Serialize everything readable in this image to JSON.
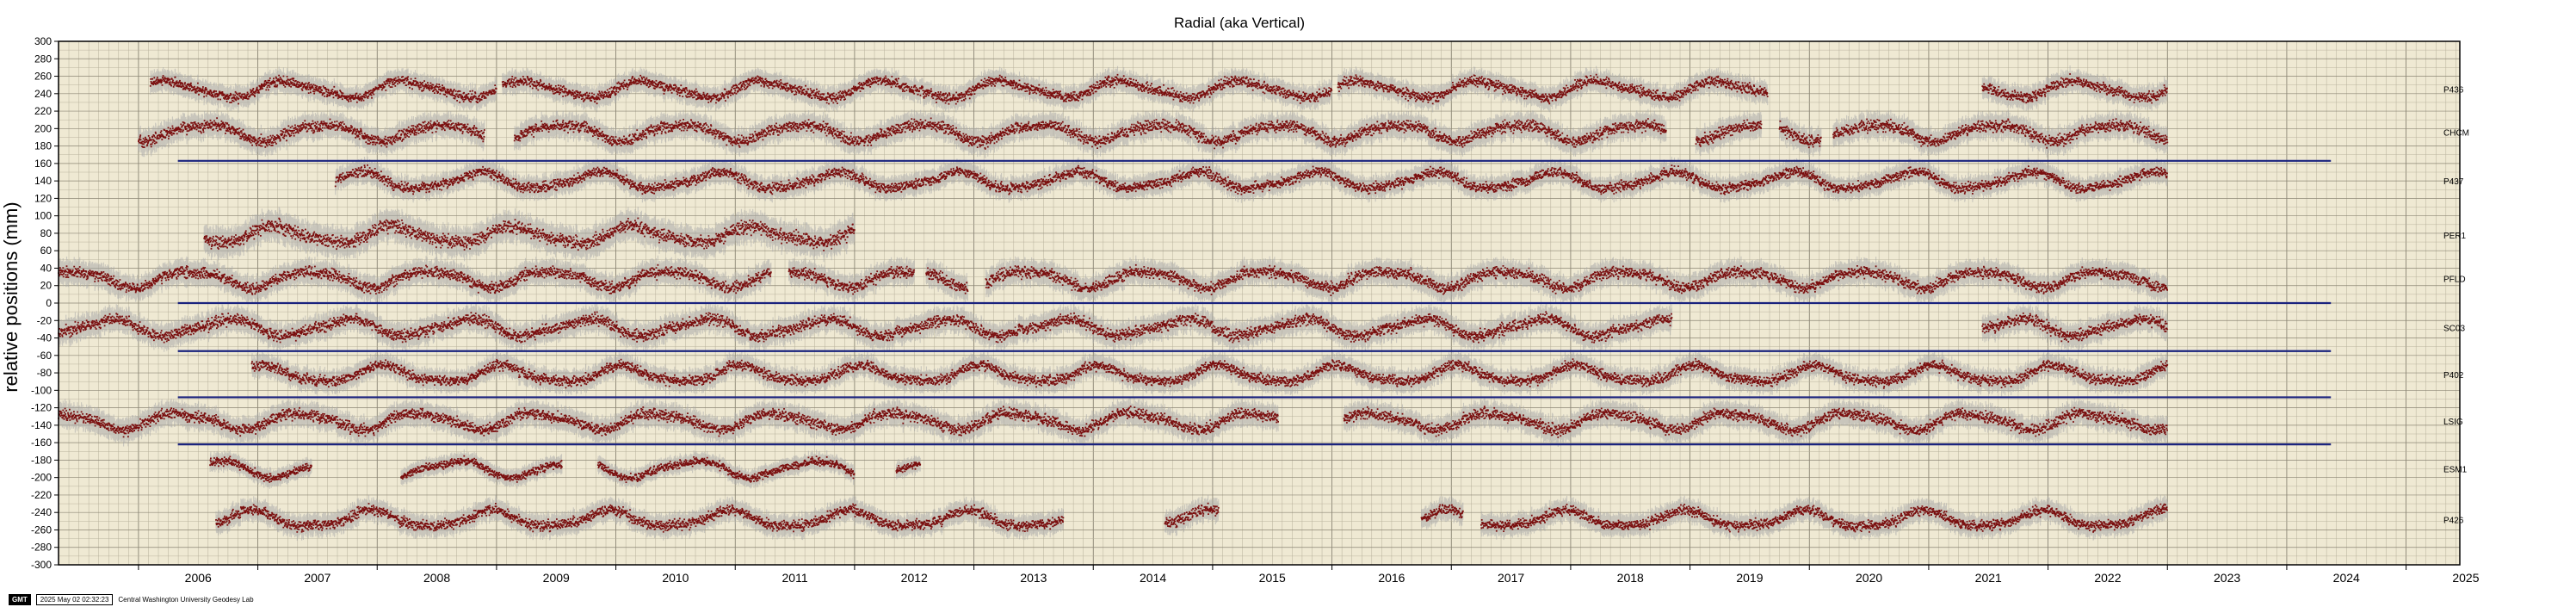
{
  "chart_data": {
    "type": "scatter",
    "title": "Radial (aka Vertical)",
    "xlabel": "",
    "ylabel": "relative positions (mm)",
    "xlim": [
      2005.33,
      2025.45
    ],
    "ylim": [
      -300,
      300
    ],
    "x_ticks": [
      "2006",
      "2007",
      "2008",
      "2009",
      "2010",
      "2011",
      "2012",
      "2013",
      "2014",
      "2015",
      "2016",
      "2017",
      "2018",
      "2019",
      "2020",
      "2021",
      "2022",
      "2023",
      "2024",
      "2025"
    ],
    "y_ticks": [
      300,
      280,
      260,
      240,
      220,
      200,
      180,
      160,
      140,
      120,
      100,
      80,
      60,
      40,
      20,
      0,
      -20,
      -40,
      -60,
      -80,
      -100,
      -120,
      -140,
      -160,
      -180,
      -200,
      -220,
      -240,
      -260,
      -280,
      -300
    ],
    "grid": true,
    "marker_color": "#7a0e0e",
    "scatter_color": "#a9a9a9",
    "background_color": "#efe9d3",
    "hline_color": "#1a237e",
    "hlines": [
      {
        "y": 163,
        "x": [
          2006.33,
          2024.37
        ]
      },
      {
        "y": 0,
        "x": [
          2006.33,
          2024.37
        ]
      },
      {
        "y": -55,
        "x": [
          2006.33,
          2024.37
        ]
      },
      {
        "y": -108,
        "x": [
          2006.33,
          2024.37
        ]
      },
      {
        "y": -162,
        "x": [
          2006.33,
          2024.37
        ]
      }
    ],
    "series": [
      {
        "name": "P436",
        "offset": 245,
        "spread": 9,
        "segments": [
          [
            2006.1,
            2009.0
          ],
          [
            2009.05,
            2016.0
          ],
          [
            2016.05,
            2019.65
          ],
          [
            2021.45,
            2023.0
          ]
        ]
      },
      {
        "name": "CHCM",
        "offset": 196,
        "spread": 10,
        "segments": [
          [
            2006.0,
            2008.9
          ],
          [
            2009.15,
            2018.8
          ],
          [
            2019.05,
            2019.6
          ],
          [
            2019.75,
            2020.1
          ],
          [
            2020.2,
            2023.0
          ]
        ]
      },
      {
        "name": "P437",
        "offset": 140,
        "spread": 9,
        "segments": [
          [
            2007.65,
            2023.0
          ]
        ]
      },
      {
        "name": "PER1",
        "offset": 78,
        "spread": 12,
        "segments": [
          [
            2006.55,
            2012.0
          ]
        ]
      },
      {
        "name": "PFLD",
        "offset": 28,
        "spread": 10,
        "segments": [
          [
            2005.33,
            2011.3
          ],
          [
            2011.45,
            2012.5
          ],
          [
            2012.6,
            2012.95
          ],
          [
            2013.1,
            2023.0
          ]
        ]
      },
      {
        "name": "SC03",
        "offset": -28,
        "spread": 10,
        "segments": [
          [
            2005.33,
            2018.85
          ],
          [
            2021.45,
            2023.0
          ]
        ]
      },
      {
        "name": "P402",
        "offset": -82,
        "spread": 9,
        "segments": [
          [
            2006.95,
            2023.0
          ]
        ]
      },
      {
        "name": "LSIG",
        "offset": -135,
        "spread": 10,
        "segments": [
          [
            2005.33,
            2015.55
          ],
          [
            2016.1,
            2023.0
          ]
        ]
      },
      {
        "name": "ESM1",
        "offset": -190,
        "spread": 7,
        "segments": [
          [
            2006.6,
            2007.45
          ],
          [
            2008.2,
            2009.55
          ],
          [
            2009.85,
            2012.0
          ],
          [
            2012.35,
            2012.55
          ]
        ]
      },
      {
        "name": "P426",
        "offset": -248,
        "spread": 9,
        "segments": [
          [
            2006.65,
            2013.75
          ],
          [
            2014.6,
            2015.05
          ],
          [
            2016.75,
            2017.1
          ],
          [
            2017.25,
            2023.0
          ]
        ]
      }
    ]
  },
  "footer": {
    "logo": "GMT",
    "timestamp": "2025 May 02 02:32:23",
    "credit": "Central Washington University Geodesy Lab"
  }
}
